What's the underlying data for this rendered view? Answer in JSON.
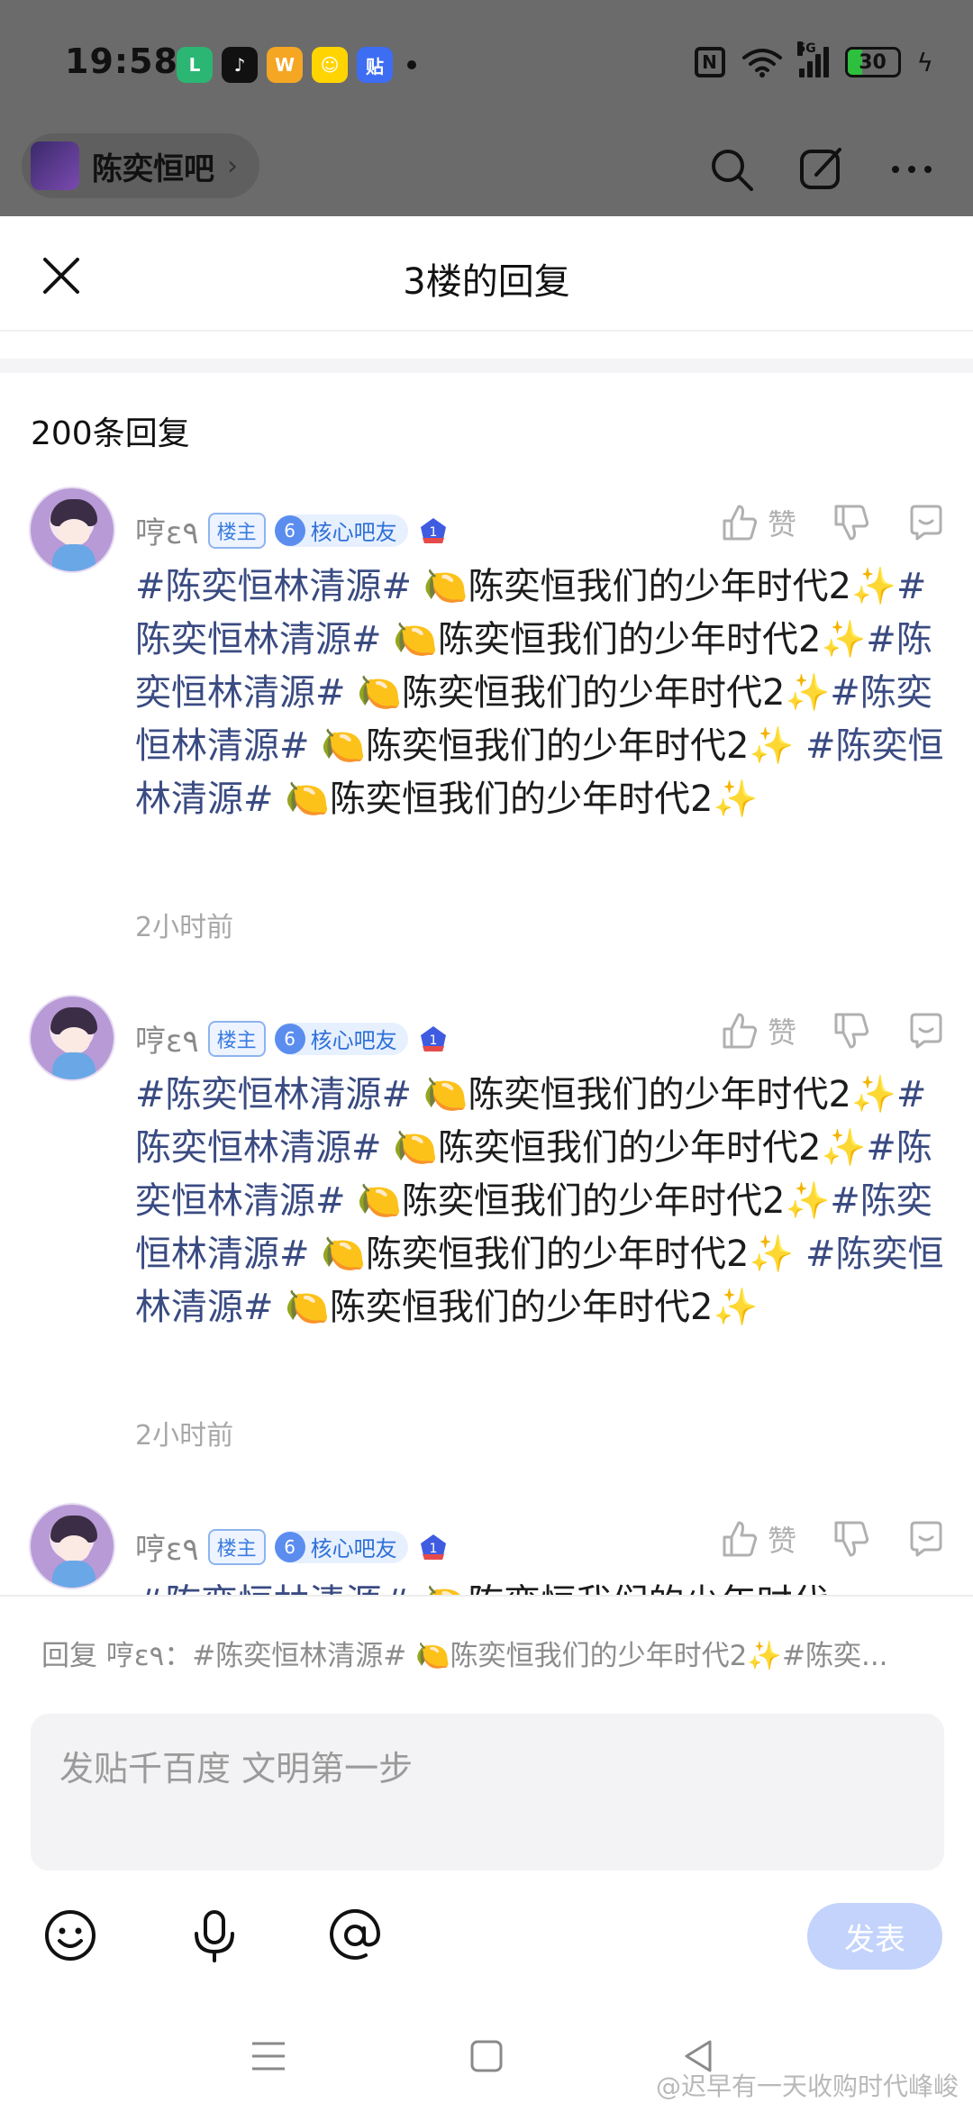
{
  "status_bar": {
    "time": "19:58",
    "apps": [
      {
        "icon": "phone-app-icon",
        "color": "#2bb673",
        "glyph": "L"
      },
      {
        "icon": "tiktok-icon",
        "color": "#111111",
        "glyph": "♪"
      },
      {
        "icon": "weibo-icon",
        "color": "#f5a623",
        "glyph": "W"
      },
      {
        "icon": "emoji-app-icon",
        "color": "#ffd400",
        "glyph": "☺"
      },
      {
        "icon": "tieba-icon",
        "color": "#3d6df2",
        "glyph": "贴"
      }
    ],
    "battery": "30",
    "battery_level": 0.3,
    "network": "5G"
  },
  "top_bar": {
    "forum_name": "陈奕恒吧"
  },
  "sheet": {
    "title": "3楼的回复",
    "reply_count": "200条回复"
  },
  "replies": [
    {
      "username": "哼ε٩",
      "owner_badge": "楼主",
      "level": "6",
      "level_title": "核心吧友",
      "like_label": "赞",
      "segments": [
        {
          "type": "tag",
          "text": "#陈奕恒林清源#"
        },
        {
          "type": "text",
          "text": " 🍋陈奕恒我们的少年时代2✨"
        },
        {
          "type": "tag",
          "text": "#陈奕恒林清源#"
        },
        {
          "type": "text",
          "text": " 🍋陈奕恒我们的少年时代2✨"
        },
        {
          "type": "tag",
          "text": "#陈奕恒林清源#"
        },
        {
          "type": "text",
          "text": " 🍋陈奕恒我们的少年时代2✨"
        },
        {
          "type": "tag",
          "text": "#陈奕恒林清源#"
        },
        {
          "type": "text",
          "text": " 🍋陈奕恒我们的少年时代2✨ "
        },
        {
          "type": "tag",
          "text": "#陈奕恒林清源#"
        },
        {
          "type": "text",
          "text": " 🍋陈奕恒我们的少年时代2✨"
        }
      ],
      "time": "2小时前"
    },
    {
      "username": "哼ε٩",
      "owner_badge": "楼主",
      "level": "6",
      "level_title": "核心吧友",
      "like_label": "赞",
      "segments": [
        {
          "type": "tag",
          "text": "#陈奕恒林清源#"
        },
        {
          "type": "text",
          "text": " 🍋陈奕恒我们的少年时代2✨"
        },
        {
          "type": "tag",
          "text": "#陈奕恒林清源#"
        },
        {
          "type": "text",
          "text": " 🍋陈奕恒我们的少年时代2✨"
        },
        {
          "type": "tag",
          "text": "#陈奕恒林清源#"
        },
        {
          "type": "text",
          "text": " 🍋陈奕恒我们的少年时代2✨"
        },
        {
          "type": "tag",
          "text": "#陈奕恒林清源#"
        },
        {
          "type": "text",
          "text": " 🍋陈奕恒我们的少年时代2✨ "
        },
        {
          "type": "tag",
          "text": "#陈奕恒林清源#"
        },
        {
          "type": "text",
          "text": " 🍋陈奕恒我们的少年时代2✨"
        }
      ],
      "time": "2小时前"
    },
    {
      "username": "哼ε٩",
      "owner_badge": "楼主",
      "level": "6",
      "level_title": "核心吧友",
      "like_label": "赞",
      "segments": [
        {
          "type": "tag",
          "text": "#陈奕恒林清源#"
        },
        {
          "type": "text",
          "text": " 🍋陈奕恒我们的少年时代"
        }
      ],
      "time": ""
    }
  ],
  "composer": {
    "reply_hint": "回复 哼ε٩：#陈奕恒林清源# 🍋陈奕恒我们的少年时代2✨#陈奕...",
    "placeholder": "发贴千百度 文明第一步",
    "send_label": "发表"
  },
  "footer": {
    "credit": "@迟早有一天收购时代峰峻"
  },
  "colors": {
    "tag": "#3a4b82",
    "send_disabled": "#c3d3fb",
    "badge_blue": "#2e6fd8"
  }
}
